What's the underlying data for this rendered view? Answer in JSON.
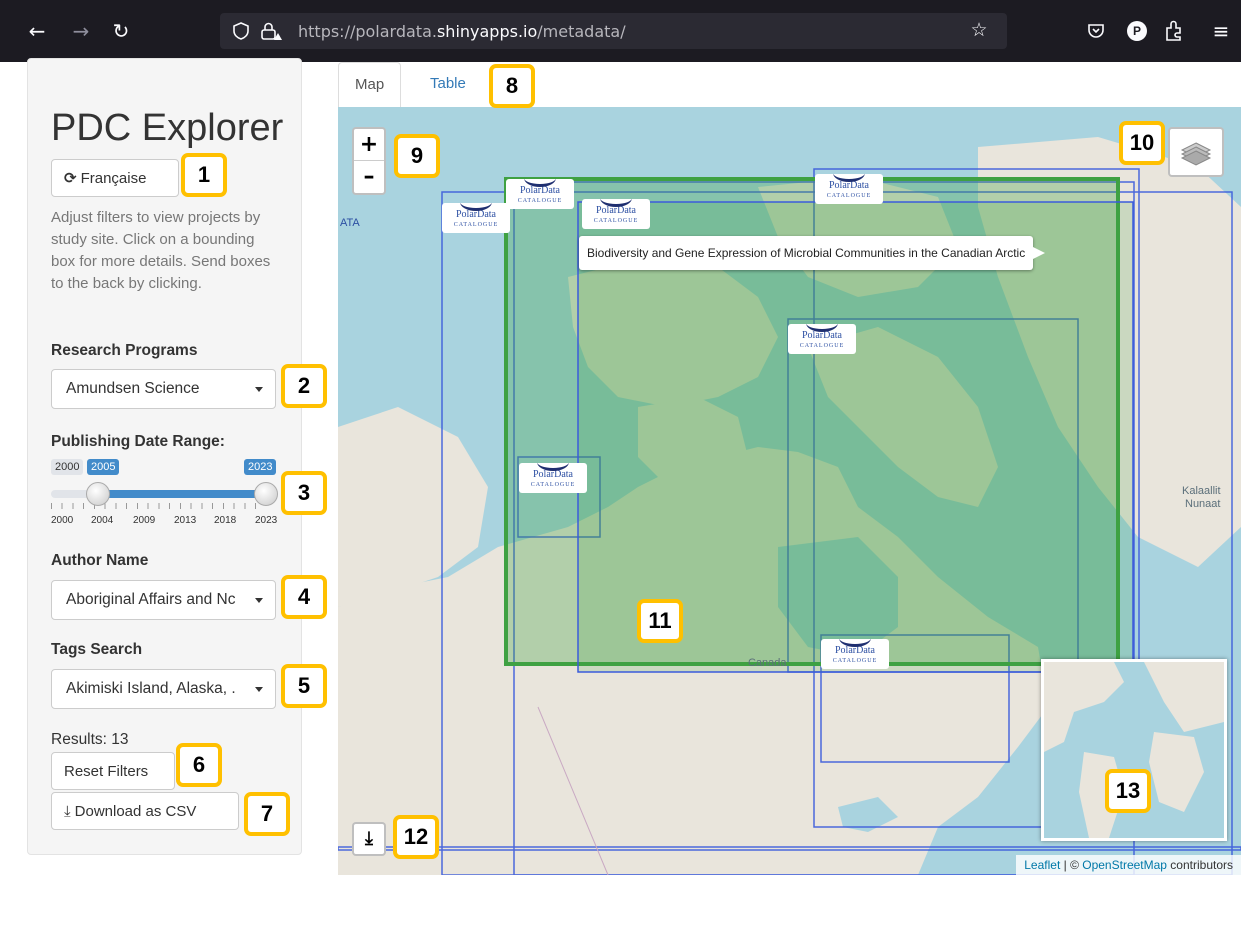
{
  "browser": {
    "url_prefix": "https://polardata.",
    "url_host": "shinyapps.io",
    "url_path": "/metadata/",
    "profile_initial": "P"
  },
  "sidebar": {
    "title": "PDC Explorer",
    "language_button": "Française",
    "instructions": "Adjust filters to view projects by study site. Click on a bounding box for more details. Send boxes to the back by clicking.",
    "research_programs": {
      "label": "Research Programs",
      "value": "Amundsen Science"
    },
    "date_range": {
      "label": "Publishing Date Range:",
      "min": "2000",
      "max": "2023",
      "from": "2005",
      "to": "2023",
      "min_year": 2000,
      "max_year": 2023,
      "ticks": [
        "2000",
        "2004",
        "2009",
        "2013",
        "2018",
        "2023"
      ]
    },
    "author": {
      "label": "Author Name",
      "value": "Aboriginal Affairs and Nc"
    },
    "tags": {
      "label": "Tags Search",
      "value": "Akimiski Island, Alaska, ."
    },
    "results": "Results: 13",
    "reset_button": "Reset Filters",
    "download_button": "Download as CSV"
  },
  "tabs": {
    "map": "Map",
    "table": "Table"
  },
  "map": {
    "zoom_in": "+",
    "zoom_out": "–",
    "tooltip": "Biodiversity and Gene Expression of Microbial Communities in the Canadian Arctic",
    "labels": {
      "canada": "Canada",
      "greenland_1": "Kalaallit",
      "greenland_2": "Nunaat",
      "edge": "ATA"
    },
    "logo_title": "PolarData",
    "logo_sub": "CATALOGUE",
    "attribution": {
      "leaflet": "Leaflet",
      "sep": " | © ",
      "osm": "OpenStreetMap",
      "tail": " contributors"
    }
  },
  "badges": [
    "1",
    "2",
    "3",
    "4",
    "5",
    "6",
    "7",
    "8",
    "9",
    "10",
    "11",
    "12",
    "13"
  ],
  "colors": {
    "accent": "#428bca",
    "badge_border": "#ffc000",
    "box_blue": "#3b5bdb",
    "box_green": "#3fa142",
    "water": "#a9d3df"
  },
  "icons": [
    "back-arrow-icon",
    "forward-arrow-icon",
    "reload-icon",
    "shield-icon",
    "lock-icon",
    "star-icon",
    "pocket-icon",
    "extensions-icon",
    "menu-icon",
    "refresh-icon",
    "download-icon",
    "layers-icon"
  ]
}
